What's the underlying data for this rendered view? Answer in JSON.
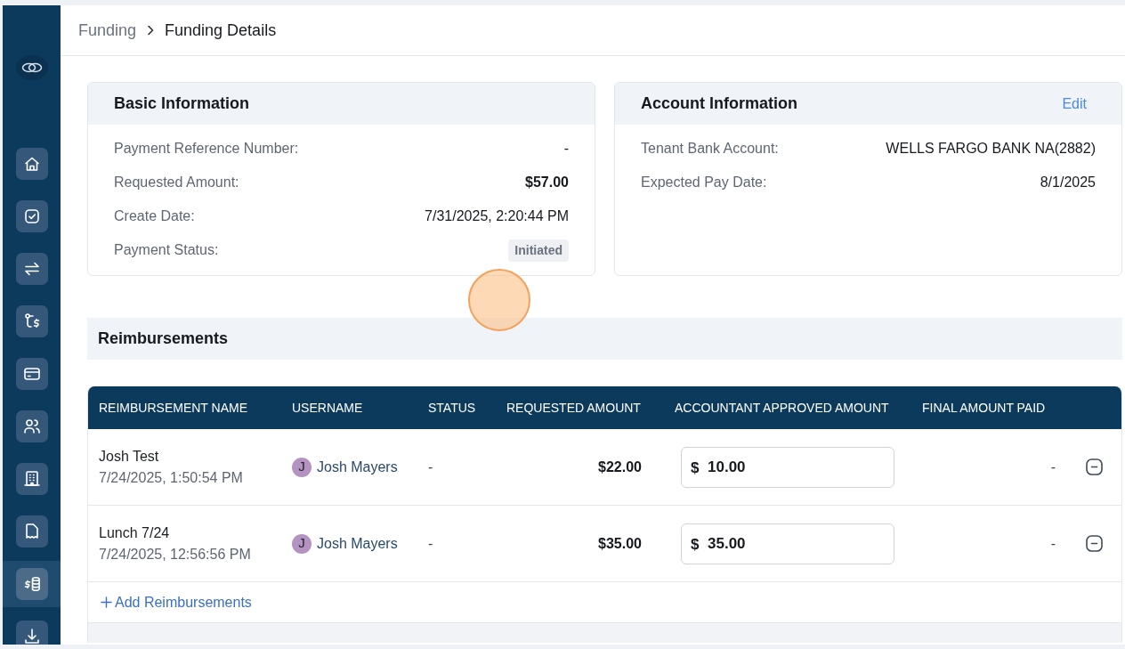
{
  "sidebar": {
    "items": [
      {
        "selected": false
      },
      {
        "selected": false
      },
      {
        "selected": false
      },
      {
        "selected": false
      },
      {
        "selected": false
      },
      {
        "selected": false
      },
      {
        "selected": false
      },
      {
        "selected": false
      },
      {
        "selected": true
      },
      {
        "selected": false
      }
    ]
  },
  "breadcrumb": [
    {
      "label": "Funding",
      "current": false
    },
    {
      "label": "Funding Details",
      "current": true
    }
  ],
  "basic_information": {
    "title": "Basic Information",
    "fields": [
      {
        "label": "Payment Reference Number:",
        "value": "-",
        "kind": "text"
      },
      {
        "label": "Requested Amount:",
        "value": "$57.00",
        "kind": "amount"
      },
      {
        "label": "Create Date:",
        "value": "7/31/2025, 2:20:44 PM",
        "kind": "text"
      },
      {
        "label": "Payment Status:",
        "value": "Initiated",
        "kind": "badge"
      }
    ]
  },
  "account_information": {
    "title": "Account Information",
    "action": "Edit",
    "fields": [
      {
        "label": "Tenant Bank Account:",
        "value": "WELLS FARGO BANK NA(2882)",
        "kind": "text"
      },
      {
        "label": "Expected Pay Date:",
        "value": "8/1/2025",
        "kind": "text"
      }
    ]
  },
  "reimbursements": {
    "title": "Reimbursements",
    "columns": [
      "REIMBURSEMENT NAME",
      "USERNAME",
      "STATUS",
      "REQUESTED AMOUNT",
      "ACCOUNTANT APPROVED AMOUNT",
      "FINAL AMOUNT PAID"
    ],
    "rows": [
      {
        "name": "Josh Test",
        "date": "7/24/2025, 1:50:54 PM",
        "user": {
          "initial": "J",
          "name": "Josh Mayers"
        },
        "status": "-",
        "requested_amount": "$22.00",
        "approved_amount": {
          "prefix": "$",
          "value": "10.00"
        },
        "final_amount_paid": "-"
      },
      {
        "name": "Lunch 7/24",
        "date": "7/24/2025, 12:56:56 PM",
        "user": {
          "initial": "J",
          "name": "Josh Mayers"
        },
        "status": "-",
        "requested_amount": "$35.00",
        "approved_amount": {
          "prefix": "$",
          "value": "35.00"
        },
        "final_amount_paid": "-"
      }
    ],
    "add_action": "Add Reimbursements"
  }
}
